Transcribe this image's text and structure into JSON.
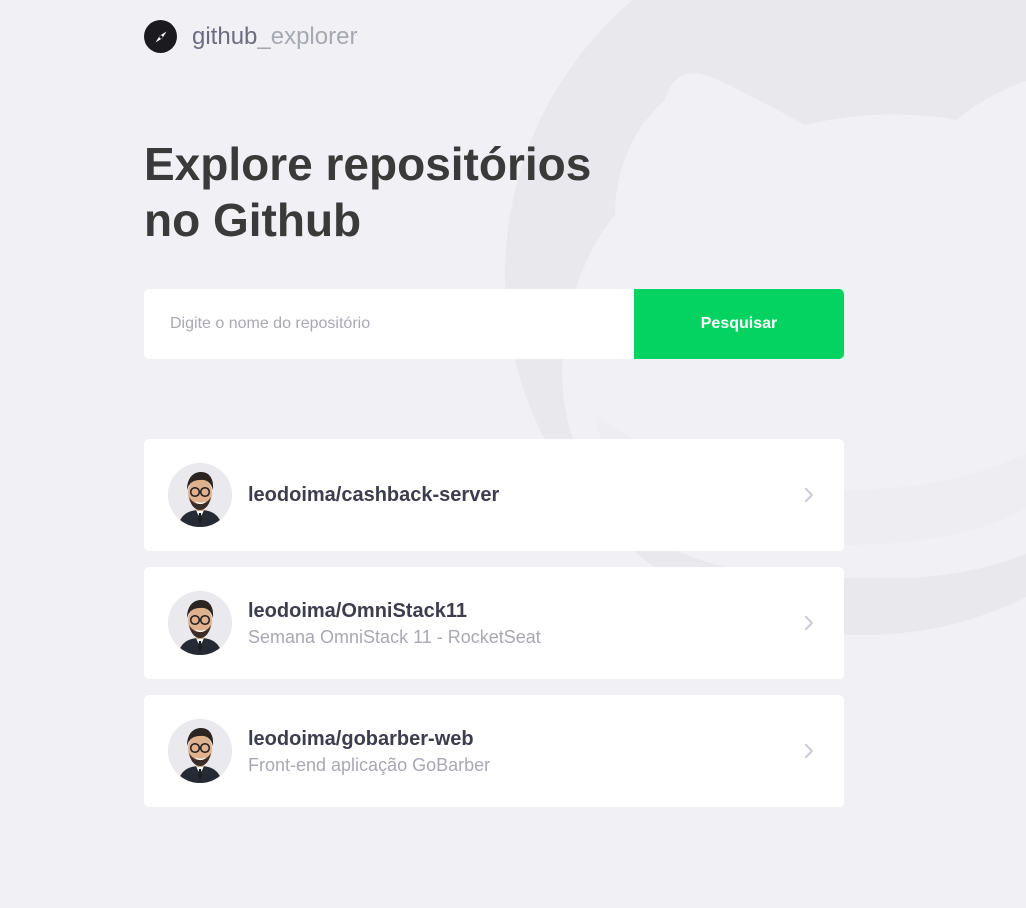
{
  "header": {
    "brand_strong": "github",
    "brand_light": "_explorer",
    "icon": "compass-icon"
  },
  "title": {
    "line1": "Explore repositórios",
    "line2": "no Github"
  },
  "search": {
    "placeholder": "Digite o nome do repositório",
    "value": "",
    "button_label": "Pesquisar"
  },
  "repositories": [
    {
      "name": "leodoima/cashback-server",
      "description": ""
    },
    {
      "name": "leodoima/OmniStack11",
      "description": "Semana OmniStack 11 - RocketSeat"
    },
    {
      "name": "leodoima/gobarber-web",
      "description": "Front-end aplicação GoBarber"
    }
  ],
  "colors": {
    "background": "#f0f0f5",
    "accent": "#04d361",
    "title": "#3a3a3a",
    "muted": "#a8a8b3",
    "card": "#ffffff"
  }
}
